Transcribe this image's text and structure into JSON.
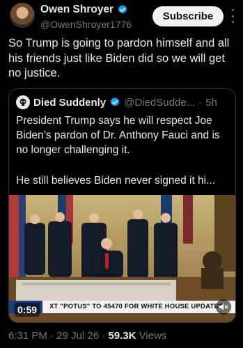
{
  "post": {
    "author_name": "Owen Shroyer",
    "author_handle": "@OwenShroyer1776",
    "subscribe_label": "Subscribe",
    "text": "So Trump is going to pardon himself and all his friends just like Biden did so we will get no justice."
  },
  "quoted": {
    "author_name": "Died Suddenly",
    "author_handle": "@DiedSudde...",
    "time": "5h",
    "separator": "·",
    "text": "President Trump says he will respect Joe Biden’s pardon of Dr. Anthony Fauci and is no longer challenging it.",
    "text2": "He still believes Biden never signed it hi...",
    "video": {
      "duration": "0:59",
      "ticker_text": "XT \"POTUS\" TO 45470 FOR WHITE HOUSE UPDATES"
    }
  },
  "footer": {
    "time": "6:31 PM",
    "date": "29 Jul 26",
    "views_count": "59.3K",
    "views_label": "Views",
    "separator": "·"
  },
  "icons": {
    "verified": "verified-badge-icon",
    "more": "more-vertical-icon",
    "mute": "speaker-muted-icon"
  },
  "colors": {
    "background": "#000000",
    "text": "#e7e9ea",
    "secondary": "#71767b",
    "verified": "#1d9bf0"
  }
}
